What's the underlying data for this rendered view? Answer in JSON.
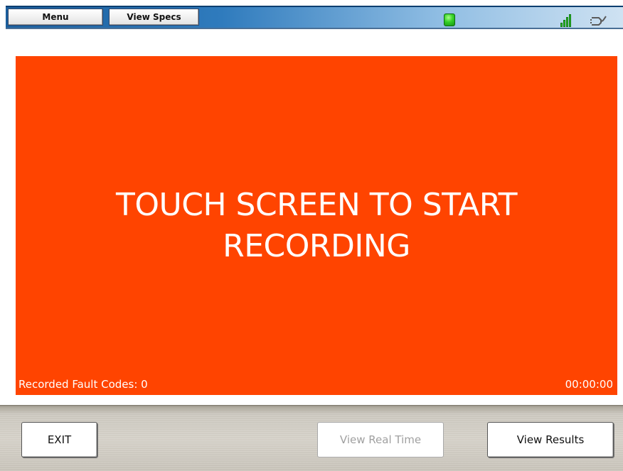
{
  "toolbar": {
    "menu_label": "Menu",
    "view_specs_label": "View Specs",
    "status_indicator_color": "#35d027",
    "icons": [
      "status-indicator",
      "signal-strength-icon",
      "plug-icon"
    ]
  },
  "main": {
    "message_line1": "TOUCH SCREEN TO START",
    "message_line2": "RECORDING",
    "fault_codes_label": "Recorded Fault Codes: 0",
    "timer": "00:00:00",
    "background_color": "#ff4400"
  },
  "footer": {
    "exit_label": "EXIT",
    "view_real_time_label": "View Real Time",
    "view_results_label": "View Results",
    "view_real_time_enabled": false
  }
}
